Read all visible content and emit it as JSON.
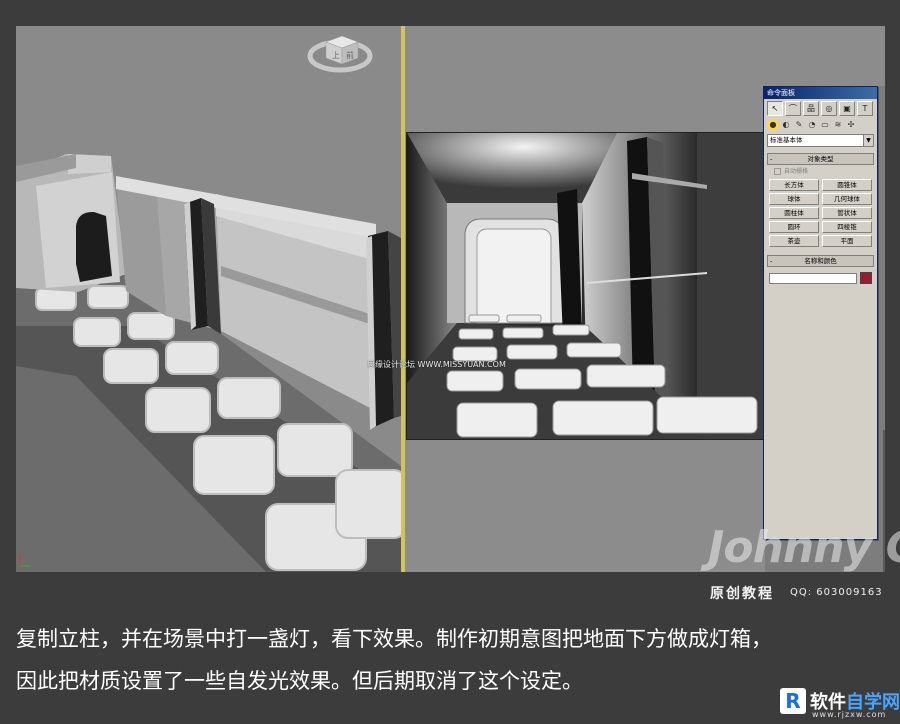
{
  "command_panel": {
    "title": "命令面板",
    "tabs": [
      "↖",
      "⌒",
      "品",
      "◎",
      "▣",
      "T"
    ],
    "subtabs": [
      "●",
      "◐",
      "✎",
      "◔",
      "▭",
      "≋",
      "✣"
    ],
    "category_select": "标准基本体",
    "object_type": {
      "header": "对象类型",
      "sign": "-",
      "autogrid_label": "自动栅格",
      "buttons": [
        "长方体",
        "圆锥体",
        "球体",
        "几何球体",
        "圆柱体",
        "管状体",
        "圆环",
        "四棱锥",
        "茶壶",
        "平面"
      ]
    },
    "name_color": {
      "header": "名称和颜色",
      "sign": "-",
      "swatch_color": "#9b1b30"
    }
  },
  "viewport": {
    "viewcube_top": "上",
    "viewcube_front": "前",
    "separator_color": "#d4c25a"
  },
  "watermark": {
    "middle": "思缘设计论坛 WWW.MISSYUAN.COM",
    "brand": "Johnny G",
    "brand_sub": "原创教程",
    "brand_qq": "QQ: 603009163"
  },
  "caption": {
    "line1": "复制立柱，并在场景中打一盏灯，看下效果。制作初期意图把地面下方做成灯箱，",
    "line2": "因此把材质设置了一些自发光效果。但后期取消了这个设定。"
  },
  "footer_logo": {
    "mark": "R",
    "name_part1": "软件",
    "name_part2": "自学网",
    "url": "www.rjzxw.com"
  }
}
